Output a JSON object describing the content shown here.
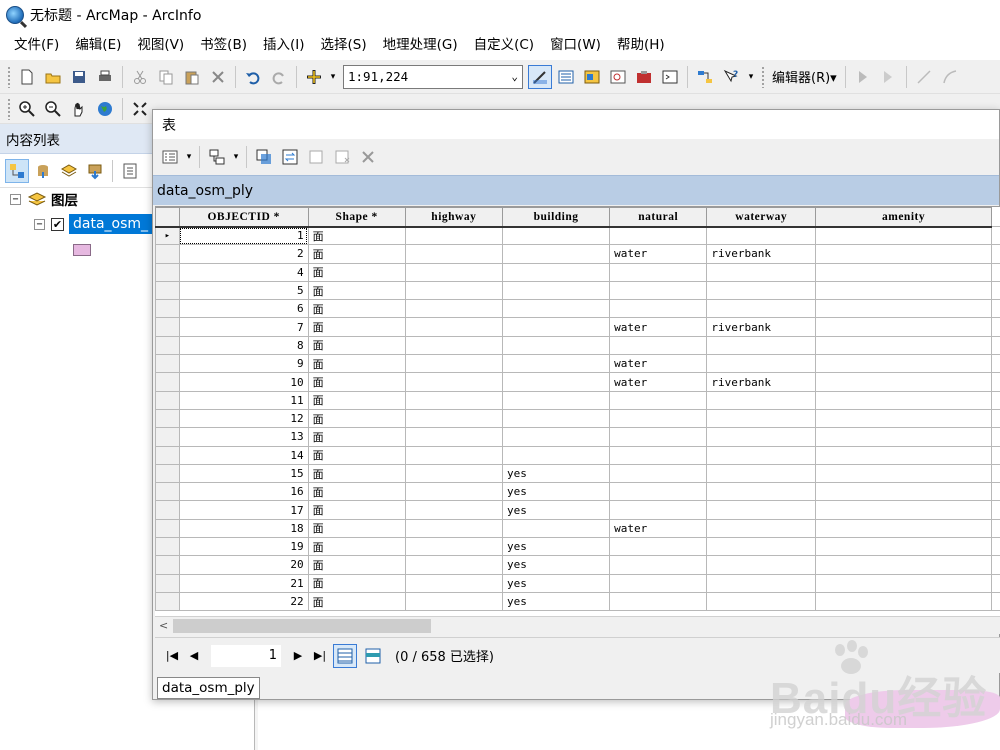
{
  "window": {
    "title": "无标题 - ArcMap - ArcInfo"
  },
  "menu": [
    "文件(F)",
    "编辑(E)",
    "视图(V)",
    "书签(B)",
    "插入(I)",
    "选择(S)",
    "地理处理(G)",
    "自定义(C)",
    "窗口(W)",
    "帮助(H)"
  ],
  "toolbar": {
    "scale": "1:91,224",
    "editor_label": "编辑器(R)▾"
  },
  "toc": {
    "title": "内容列表",
    "group_label": "图层",
    "layer_name": "data_osm_",
    "swatch_color": "#e6b8e0"
  },
  "table_window": {
    "title": "表",
    "table_name": "data_osm_ply",
    "columns": [
      "OBJECTID *",
      "Shape *",
      "highway",
      "building",
      "natural",
      "waterway",
      "amenity"
    ],
    "rows": [
      [
        "1",
        "面",
        "",
        "",
        "",
        "",
        ""
      ],
      [
        "2",
        "面",
        "",
        "",
        "water",
        "riverbank",
        ""
      ],
      [
        "4",
        "面",
        "",
        "",
        "",
        "",
        ""
      ],
      [
        "5",
        "面",
        "",
        "",
        "",
        "",
        ""
      ],
      [
        "6",
        "面",
        "",
        "",
        "",
        "",
        ""
      ],
      [
        "7",
        "面",
        "",
        "",
        "water",
        "riverbank",
        ""
      ],
      [
        "8",
        "面",
        "",
        "",
        "",
        "",
        ""
      ],
      [
        "9",
        "面",
        "",
        "",
        "water",
        "",
        ""
      ],
      [
        "10",
        "面",
        "",
        "",
        "water",
        "riverbank",
        ""
      ],
      [
        "11",
        "面",
        "",
        "",
        "",
        "",
        ""
      ],
      [
        "12",
        "面",
        "",
        "",
        "",
        "",
        ""
      ],
      [
        "13",
        "面",
        "",
        "",
        "",
        "",
        ""
      ],
      [
        "14",
        "面",
        "",
        "",
        "",
        "",
        ""
      ],
      [
        "15",
        "面",
        "",
        "yes",
        "",
        "",
        ""
      ],
      [
        "16",
        "面",
        "",
        "yes",
        "",
        "",
        ""
      ],
      [
        "17",
        "面",
        "",
        "yes",
        "",
        "",
        ""
      ],
      [
        "18",
        "面",
        "",
        "",
        "water",
        "",
        ""
      ],
      [
        "19",
        "面",
        "",
        "yes",
        "",
        "",
        ""
      ],
      [
        "20",
        "面",
        "",
        "yes",
        "",
        "",
        ""
      ],
      [
        "21",
        "面",
        "",
        "yes",
        "",
        "",
        ""
      ],
      [
        "22",
        "面",
        "",
        "yes",
        "",
        "",
        ""
      ]
    ],
    "current_row_marker": "▸",
    "page_number": "1",
    "selection_status": "(0 / 658 已选择)",
    "bottom_tab": "data_osm_ply"
  },
  "watermark": {
    "brand": "Baidu经验",
    "url": "jingyan.baidu.com"
  }
}
